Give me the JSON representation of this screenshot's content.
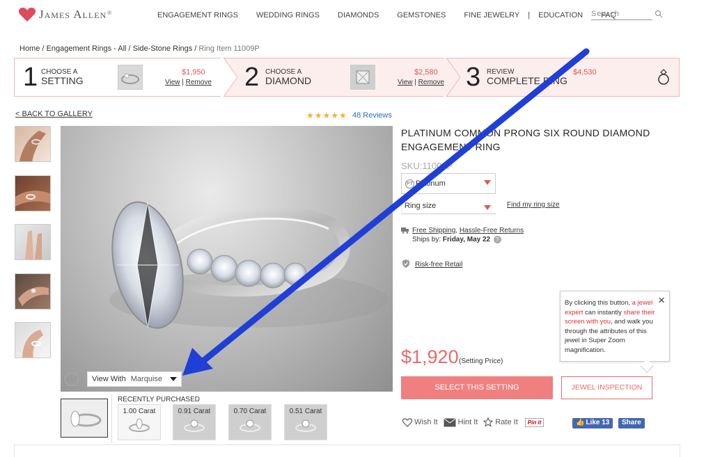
{
  "brand": {
    "name": "James Allen",
    "trademark": "®",
    "accent": "#e86a6a",
    "heart_color": "#e04a5a"
  },
  "nav": {
    "items": [
      "ENGAGEMENT RINGS",
      "WEDDING RINGS",
      "DIAMONDS",
      "GEMSTONES",
      "FINE JEWELRY",
      "EDUCATION",
      "FAQ"
    ],
    "separator": "|"
  },
  "search": {
    "placeholder": "Search",
    "icon": "search-icon"
  },
  "breadcrumb": {
    "home": "Home",
    "sep1": " / ",
    "level1": "Engagement Rings - All",
    "sep2": " / ",
    "level2": "Side-Stone Rings",
    "sep3": " / ",
    "current": "Ring Item 11009P"
  },
  "steps": [
    {
      "num": "1",
      "small": "CHOOSE A",
      "big": "SETTING",
      "price": "$1,950",
      "view": "View",
      "sep": " | ",
      "remove": "Remove"
    },
    {
      "num": "2",
      "small": "CHOOSE A",
      "big": "DIAMOND",
      "price": "$2,580",
      "view": "View",
      "sep": " | ",
      "remove": "Remove"
    },
    {
      "num": "3",
      "small": "REVIEW",
      "big": "COMPLETE RING",
      "price": "$4,530",
      "icon": "ring-icon"
    }
  ],
  "gallery": {
    "back_label": "< BACK TO GALLERY",
    "stars": "★★★★★",
    "reviews": "48 Reviews",
    "view_with_label": "View With",
    "view_with_value": "Marquise",
    "icon_360": "360°"
  },
  "recent": {
    "label": "RECENTLY PURCHASED",
    "items": [
      "1.00 Carat",
      "0.91 Carat",
      "0.70 Carat",
      "0.51 Carat"
    ]
  },
  "product": {
    "title": "PLATINUM COMMON PRONG SIX ROUND DIAMOND ENGAGEMENT RING",
    "sku": "SKU:11009P",
    "metal": "Platinum",
    "metal_badge": "PT",
    "ring_size_placeholder": "Ring size",
    "find_size": "Find my ring size",
    "free_shipping": "Free Shipping",
    "comma": ", ",
    "returns": "Hassle-Free Returns",
    "ships_by_label": "Ships by: ",
    "ships_by_date": "Friday, May 22",
    "qmark": "?",
    "risk_free": "Risk-free Retail",
    "price": "$1,920",
    "price_note": "(Setting Price)",
    "select_btn": "SELECT THIS SETTING",
    "inspect_btn": "JEWEL INSPECTION"
  },
  "tooltip": {
    "t1": "By clicking this button, ",
    "t2": "a jewel expert",
    "t3": " can instantly ",
    "t4": "share their screen with you",
    "t5": ", and walk you through the attributes of this jewel in Super Zoom magnification.",
    "close": "×"
  },
  "social": {
    "wish": "Wish It",
    "hint": "Hint It",
    "rate": "Rate It",
    "pin": "Pin it",
    "like": "Like 13",
    "share": "Share"
  },
  "annotation": {
    "arrow_color": "#1f3fd6"
  }
}
